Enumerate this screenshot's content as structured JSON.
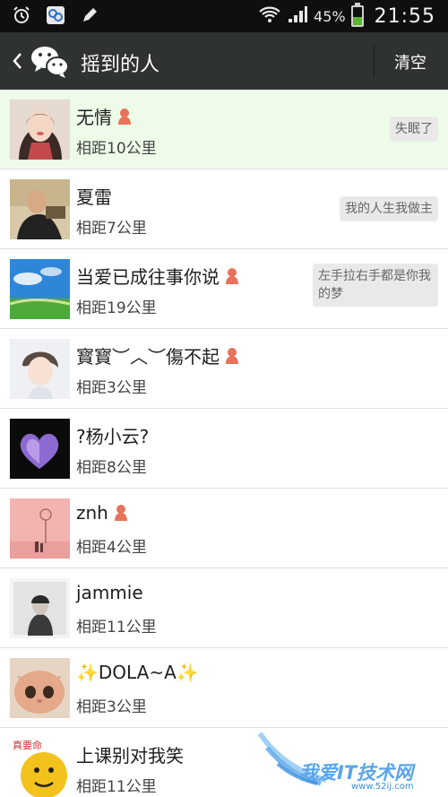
{
  "status_bar": {
    "battery_pct_label": "45%",
    "battery_level": 0.45,
    "time": "21:55",
    "icons": [
      "alarm-icon",
      "photo-app-icon",
      "pen-icon",
      "wifi-icon",
      "signal-icon",
      "battery-icon"
    ]
  },
  "header": {
    "title": "摇到的人",
    "clear_label": "清空",
    "icons": [
      "back-icon",
      "wechat-logo-icon"
    ]
  },
  "people": [
    {
      "name": "无情",
      "distance": "相距10公里",
      "gender": "female",
      "signature": "失眠了",
      "highlighted": true
    },
    {
      "name": "夏雷",
      "distance": "相距7公里",
      "gender": "",
      "signature": "我的人生我做主",
      "highlighted": false
    },
    {
      "name": "当爱已成往事你说",
      "distance": "相距19公里",
      "gender": "female",
      "signature": "左手拉右手都是你我的梦",
      "highlighted": false
    },
    {
      "name": "寳寳︶︿︶傷不起",
      "distance": "相距3公里",
      "gender": "female",
      "signature": "",
      "highlighted": false
    },
    {
      "name": "?杨小云?",
      "distance": "相距8公里",
      "gender": "",
      "signature": "",
      "highlighted": false
    },
    {
      "name": "znh",
      "distance": "相距4公里",
      "gender": "female",
      "signature": "",
      "highlighted": false
    },
    {
      "name": "jammie",
      "distance": "相距11公里",
      "gender": "",
      "signature": "",
      "highlighted": false
    },
    {
      "name": "✨DOLA~A✨",
      "distance": "相距3公里",
      "gender": "",
      "signature": "",
      "highlighted": false
    },
    {
      "name": "上课别对我笑",
      "distance": "相距11公里",
      "gender": "",
      "signature": "",
      "highlighted": false
    }
  ],
  "watermark": {
    "text": "我爱IT技术网",
    "url": "www.52ij.com"
  },
  "colors": {
    "status_bar": "#0f0f0f",
    "title_bar": "#2f3233",
    "highlight_row": "#eefbe9",
    "female_icon": "#e8735a",
    "battery_fill": "#57b82b"
  }
}
